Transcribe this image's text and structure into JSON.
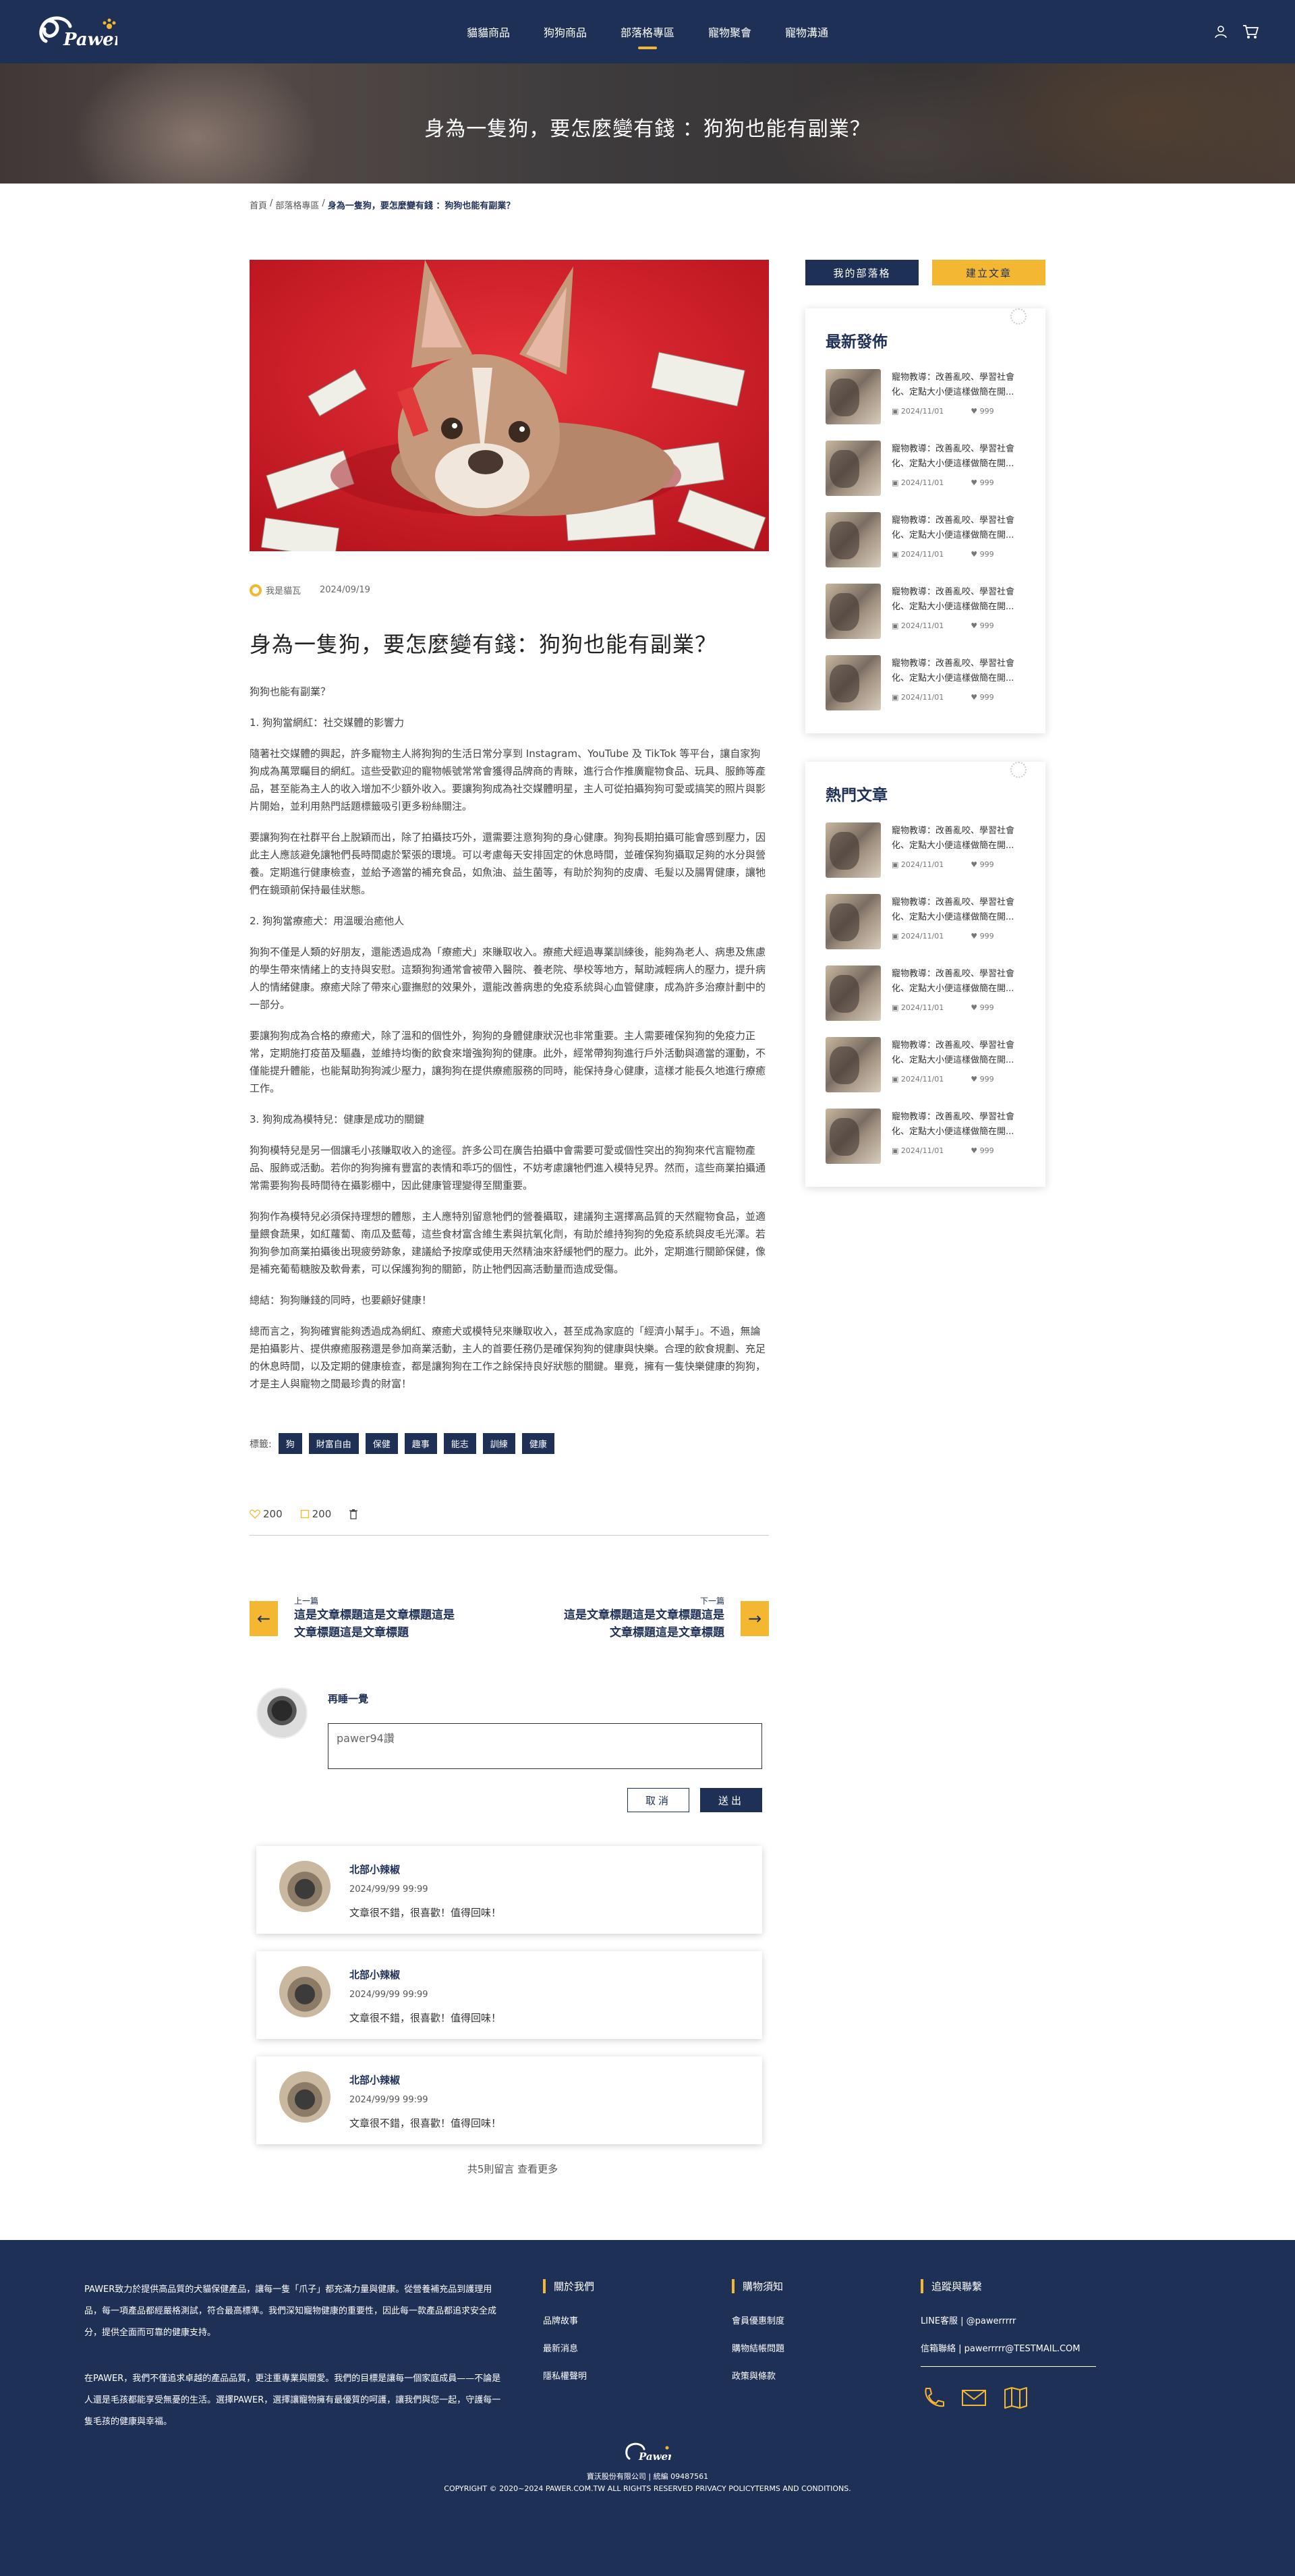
{
  "header": {
    "logo_text": "Pawer",
    "nav": [
      {
        "label": "貓貓商品",
        "active": false
      },
      {
        "label": "狗狗商品",
        "active": false
      },
      {
        "label": "部落格專區",
        "active": true
      },
      {
        "label": "寵物聚會",
        "active": false
      },
      {
        "label": "寵物溝通",
        "active": false
      }
    ],
    "icons": [
      "user-icon",
      "cart-icon"
    ]
  },
  "hero": {
    "title": "身為一隻狗，要怎麼變有錢 ：狗狗也能有副業？"
  },
  "breadcrumb": {
    "home": "首頁",
    "sep1": "/",
    "section": "部落格專區",
    "sep2": "/",
    "current": "身為一隻狗，要怎麼變有錢 ：狗狗也能有副業？"
  },
  "article": {
    "author": "我是貓瓦",
    "date": "2024/09/19",
    "title": "身為一隻狗，要怎麼變有錢：狗狗也能有副業？",
    "paragraphs": [
      "狗狗也能有副業？",
      "1. 狗狗當網紅：社交媒體的影響力",
      "隨著社交媒體的興起，許多寵物主人將狗狗的生活日常分享到 Instagram、YouTube 及 TikTok 等平台，讓自家狗狗成為萬眾矚目的網紅。這些受歡迎的寵物帳號常常會獲得品牌商的青睞，進行合作推廣寵物食品、玩具、服飾等產品，甚至能為主人的收入增加不少額外收入。要讓狗狗成為社交媒體明星，主人可從拍攝狗狗可愛或搞笑的照片與影片開始，並利用熱門話題標籤吸引更多粉絲關注。",
      "要讓狗狗在社群平台上脫穎而出，除了拍攝技巧外，還需要注意狗狗的身心健康。狗狗長期拍攝可能會感到壓力，因此主人應該避免讓牠們長時間處於緊張的環境。可以考慮每天安排固定的休息時間，並確保狗狗攝取足夠的水分與營養。定期進行健康檢查，並給予適當的補充食品，如魚油、益生菌等，有助於狗狗的皮膚、毛髮以及腸胃健康，讓牠們在鏡頭前保持最佳狀態。",
      "2. 狗狗當療癒犬：用溫暖治癒他人",
      "狗狗不僅是人類的好朋友，還能透過成為「療癒犬」來賺取收入。療癒犬經過專業訓練後，能夠為老人、病患及焦慮的學生帶來情緒上的支持與安慰。這類狗狗通常會被帶入醫院、養老院、學校等地方，幫助減輕病人的壓力，提升病人的情緒健康。療癒犬除了帶來心靈撫慰的效果外，還能改善病患的免疫系統與心血管健康，成為許多治療計劃中的一部分。",
      "要讓狗狗成為合格的療癒犬，除了溫和的個性外，狗狗的身體健康狀況也非常重要。主人需要確保狗狗的免疫力正常，定期施打疫苗及驅蟲，並維持均衡的飲食來增強狗狗的健康。此外，經常帶狗狗進行戶外活動與適當的運動，不僅能提升體能，也能幫助狗狗減少壓力，讓狗狗在提供療癒服務的同時，能保持身心健康，這樣才能長久地進行療癒工作。",
      "3. 狗狗成為模特兒：健康是成功的關鍵",
      "狗狗模特兒是另一個讓毛小孩賺取收入的途徑。許多公司在廣告拍攝中會需要可愛或個性突出的狗狗來代言寵物產品、服飾或活動。若你的狗狗擁有豐富的表情和乖巧的個性，不妨考慮讓牠們進入模特兒界。然而，這些商業拍攝通常需要狗狗長時間待在攝影棚中，因此健康管理變得至關重要。",
      "狗狗作為模特兒必須保持理想的體態，主人應特別留意牠們的營養攝取，建議狗主選擇高品質的天然寵物食品，並適量餵食蔬果，如紅蘿蔔、南瓜及藍莓，這些食材富含維生素與抗氧化劑，有助於維持狗狗的免疫系統與皮毛光澤。若狗狗參加商業拍攝後出現疲勞跡象，建議給予按摩或使用天然精油來舒緩牠們的壓力。此外，定期進行關節保健，像是補充葡萄糖胺及軟骨素，可以保護狗狗的關節，防止牠們因高活動量而造成受傷。",
      "總結：狗狗賺錢的同時，也要顧好健康！",
      "總而言之，狗狗確實能夠透過成為網紅、療癒犬或模特兒來賺取收入，甚至成為家庭的「經濟小幫手」。不過，無論是拍攝影片、提供療癒服務還是參加商業活動，主人的首要任務仍是確保狗狗的健康與快樂。合理的飲食規劃、充足的休息時間，以及定期的健康檢查，都是讓狗狗在工作之餘保持良好狀態的關鍵。畢竟，擁有一隻快樂健康的狗狗，才是主人與寵物之間最珍貴的財富！"
    ],
    "tags_label": "標籤:",
    "tags": [
      "狗",
      "財富自由",
      "保健",
      "趣事",
      "能志",
      "訓練",
      "健康"
    ],
    "likes": "200",
    "saves": "200"
  },
  "post_nav": {
    "prev_label": "上一篇",
    "prev_title": "這是文章標題這是文章標題這是文章標題這是文章標題",
    "next_label": "下一篇",
    "next_title": "這是文章標題這是文章標題這是文章標題這是文章標題"
  },
  "comment_form": {
    "user": "再睡一覺",
    "value": "pawer94讚",
    "cancel": "取消",
    "submit": "送出"
  },
  "comments": [
    {
      "name": "北部小辣椒",
      "date": "2024/99/99 99:99",
      "text": "文章很不錯，很喜歡！值得回味！"
    },
    {
      "name": "北部小辣椒",
      "date": "2024/99/99 99:99",
      "text": "文章很不錯，很喜歡！值得回味！"
    },
    {
      "name": "北部小辣椒",
      "date": "2024/99/99 99:99",
      "text": "文章很不錯，很喜歡！值得回味！"
    }
  ],
  "comments_more": "共5則留言 查看更多",
  "sidebar": {
    "my_blog": "我的部落格",
    "create": "建立文章",
    "latest_title": "最新發佈",
    "latest": [
      {
        "title": "寵物教導：改善亂咬、學習社會化、定點大小便這樣做簡在開...",
        "date": "2024/11/01",
        "likes": "999"
      },
      {
        "title": "寵物教導：改善亂咬、學習社會化、定點大小便這樣做簡在開...",
        "date": "2024/11/01",
        "likes": "999"
      },
      {
        "title": "寵物教導：改善亂咬、學習社會化、定點大小便這樣做簡在開...",
        "date": "2024/11/01",
        "likes": "999"
      },
      {
        "title": "寵物教導：改善亂咬、學習社會化、定點大小便這樣做簡在開...",
        "date": "2024/11/01",
        "likes": "999"
      },
      {
        "title": "寵物教導：改善亂咬、學習社會化、定點大小便這樣做簡在開...",
        "date": "2024/11/01",
        "likes": "999"
      }
    ],
    "hot_title": "熱門文章",
    "hot": [
      {
        "title": "寵物教導：改善亂咬、學習社會化、定點大小便這樣做簡在開...",
        "date": "2024/11/01",
        "likes": "999"
      },
      {
        "title": "寵物教導：改善亂咬、學習社會化、定點大小便這樣做簡在開...",
        "date": "2024/11/01",
        "likes": "999"
      },
      {
        "title": "寵物教導：改善亂咬、學習社會化、定點大小便這樣做簡在開...",
        "date": "2024/11/01",
        "likes": "999"
      },
      {
        "title": "寵物教導：改善亂咬、學習社會化、定點大小便這樣做簡在開...",
        "date": "2024/11/01",
        "likes": "999"
      },
      {
        "title": "寵物教導：改善亂咬、學習社會化、定點大小便這樣做簡在開...",
        "date": "2024/11/01",
        "likes": "999"
      }
    ]
  },
  "footer": {
    "desc1": "PAWER致力於提供高品質的犬貓保健產品，讓每一隻「爪子」都充滿力量與健康。從營養補充品到護理用品，每一項產品都經嚴格測試，符合最高標準。我們深知寵物健康的重要性，因此每一款產品都追求安全成分，提供全面而可靠的健康支持。",
    "desc2": "在PAWER，我們不僅追求卓越的產品品質，更注重專業與關愛。我們的目標是讓每一個家庭成員——不論是人還是毛孩都能享受無憂的生活。選擇PAWER，選擇讓寵物擁有最優質的呵護，讓我們與您一起，守護每一隻毛孩的健康與幸福。",
    "col1_title": "關於我們",
    "col1_links": [
      "品牌故事",
      "最新消息",
      "隱私權聲明"
    ],
    "col2_title": "購物須知",
    "col2_links": [
      "會員優惠制度",
      "購物結帳問題",
      "政策與條款"
    ],
    "col3_title": "追蹤與聯繫",
    "line_label": "LINE客服 | @pawerrrrr",
    "mail_label": "信箱聯絡 | pawerrrrr@TESTMAIL.COM",
    "social_icons": [
      "phone-icon",
      "mail-icon",
      "map-icon"
    ],
    "company": "寶沃股份有限公司 | 統編 09487561",
    "copyright": "COPYRIGHT © 2020~2024 PAWER.COM.TW ALL RIGHTS RESERVED PRIVACY POLICYTERMS AND CONDITIONS."
  },
  "colors": {
    "navy": "#1f3057",
    "accent": "#f4b731"
  }
}
